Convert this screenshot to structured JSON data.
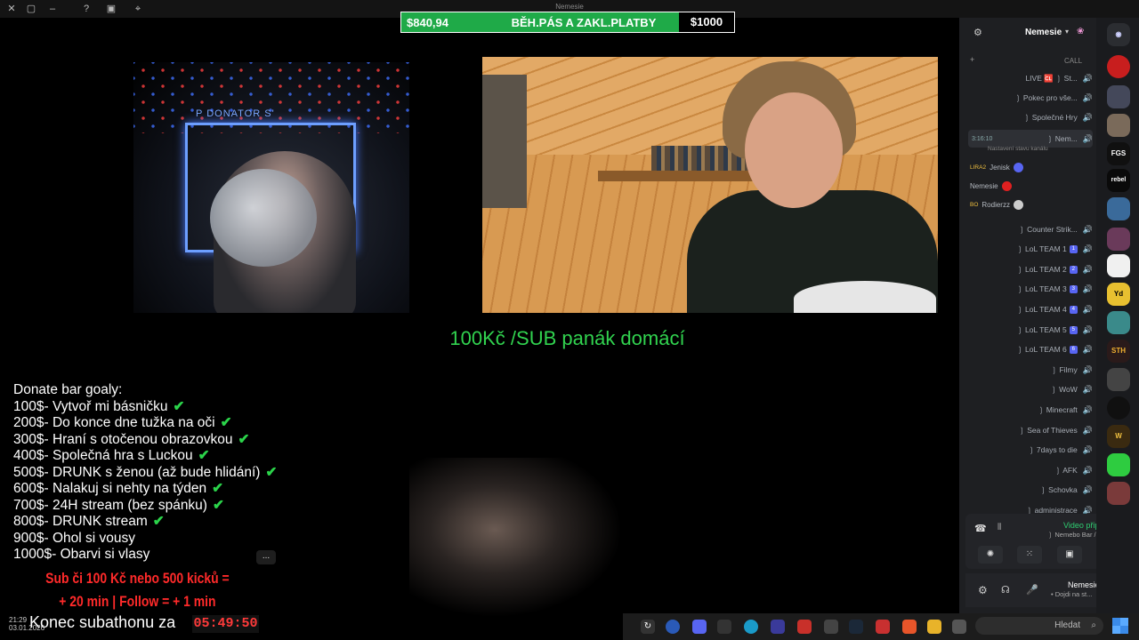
{
  "window": {
    "title": "Nemesie"
  },
  "donation_bar": {
    "current": "$840,94",
    "label": "BĚH.PÁS A ZAKL.PLATBY",
    "goal": "$1000",
    "progress": 0.84
  },
  "webcam_left": {
    "neon_sign": "P DONATOR S'"
  },
  "sub_text": "100Kč /SUB panák domácí",
  "goals": {
    "title": "Donate bar goaly:",
    "items": [
      {
        "text": "100$- Vytvoř mi básničku",
        "done": true
      },
      {
        "text": "200$- Do konce dne tužka na oči",
        "done": true
      },
      {
        "text": "300$- Hraní s otočenou obrazovkou",
        "done": true
      },
      {
        "text": "400$- Společná hra s Luckou",
        "done": true
      },
      {
        "text": "500$- DRUNK s ženou (až bude hlidání)",
        "done": true
      },
      {
        "text": "600$- Nalakuj si nehty na týden",
        "done": true
      },
      {
        "text": "700$- 24H stream (bez spánku)",
        "done": true
      },
      {
        "text": "800$-  DRUNK stream",
        "done": true
      },
      {
        "text": "900$- Ohol si vousy",
        "done": false
      },
      {
        "text": "1000$- Obarvi si vlasy",
        "done": false
      }
    ],
    "check_glyph": "✔"
  },
  "promo": {
    "line1": "Sub či 100 Kč nebo 500 kicků =",
    "line2": "+ 20 min | Follow = + 1 min"
  },
  "ellipsis": "...",
  "footer": {
    "tray_time": "21:29",
    "tray_date": "03.01.2026",
    "countdown_label": "Konec subathonu za",
    "countdown": "05:49:50"
  },
  "taskbar": {
    "search_placeholder": "Hledat",
    "search_icon": "search-icon"
  },
  "discord": {
    "server_name": "Nemesie",
    "category": "CALL",
    "channels_top": [
      {
        "name": "LIVE 🆑 ❳ St...",
        "icon": "live-icon"
      },
      {
        "name": "❳ Pokec pro vše...",
        "icon": "megaphone-icon"
      },
      {
        "name": "❳ Společné Hry",
        "icon": "gamepad-icon"
      }
    ],
    "active_channel": {
      "name": "❳ Nem...",
      "time": "3:16:10",
      "status": "Nastavení stavu kanálu"
    },
    "users": [
      {
        "name": "Jenisk",
        "tag": "LIRA2",
        "color": "#5865f2"
      },
      {
        "name": "Nemesie",
        "tag": "",
        "color": "#e02020"
      },
      {
        "name": "Rodierzz",
        "tag": "BO",
        "color": "#cccccc"
      }
    ],
    "channels": [
      {
        "name": "❳ Counter Strik...",
        "badge": ""
      },
      {
        "name": "❳ LoL TEAM 1",
        "badge": "1"
      },
      {
        "name": "❳ LoL TEAM 2",
        "badge": "2"
      },
      {
        "name": "❳ LoL TEAM 3",
        "badge": "3"
      },
      {
        "name": "❳ LoL TEAM 4",
        "badge": "4"
      },
      {
        "name": "❳ LoL TEAM 5",
        "badge": "5"
      },
      {
        "name": "❳ LoL TEAM 6",
        "badge": "6"
      },
      {
        "name": "❳ Filmy",
        "badge": ""
      },
      {
        "name": "❳ WoW",
        "badge": ""
      },
      {
        "name": "❳ Minecraft",
        "badge": ""
      },
      {
        "name": "❳ Sea of Thieves",
        "badge": ""
      },
      {
        "name": "❳ 7days to die",
        "badge": ""
      },
      {
        "name": "❳ AFK",
        "badge": ""
      },
      {
        "name": "❳ Schovka",
        "badge": ""
      },
      {
        "name": "❳ administrace",
        "badge": ""
      }
    ],
    "voice_status": "Video připojeno",
    "voice_channel": "❳ Nemebo Bar / Ne...",
    "me": {
      "name": "Nemesie",
      "status": "• Dojdi na st..."
    }
  },
  "servers": [
    "FGS",
    "rebel",
    "STH",
    "W",
    "Yd"
  ],
  "colors": {
    "accent_green": "#31d34f",
    "promo_red": "#ff2a2a",
    "bar_green": "#1faa48",
    "discord_bg": "#1e1f22"
  }
}
